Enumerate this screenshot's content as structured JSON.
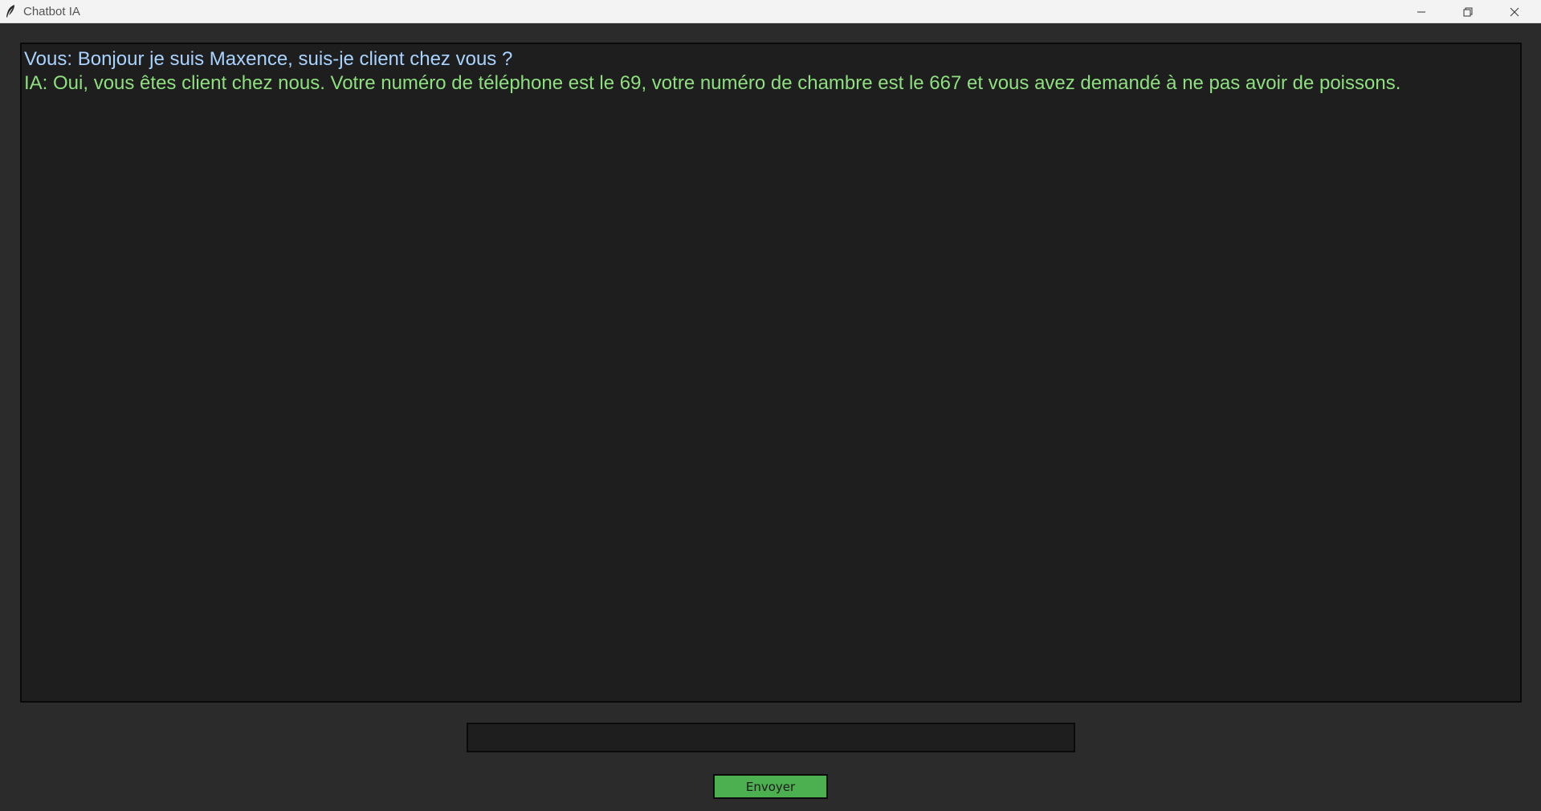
{
  "window": {
    "title": "Chatbot IA",
    "icons": {
      "app": "feather-icon",
      "minimize": "minimize-icon",
      "maximize": "restore-icon",
      "close": "close-icon"
    }
  },
  "chat": {
    "messages": [
      {
        "text": "Vous: Bonjour je suis Maxence, suis-je client chez vous ?"
      },
      {
        "text": "IA: Oui, vous êtes client chez nous. Votre numéro de téléphone est le 69, votre numéro de chambre est le 667 et vous avez demandé à ne pas avoir de poissons."
      }
    ]
  },
  "input": {
    "value": "",
    "placeholder": ""
  },
  "send_button": {
    "label": "Envoyer"
  },
  "colors": {
    "background": "#2b2b2b",
    "chat_background": "#1e1e1e",
    "user_text": "#a9d3ff",
    "ai_text": "#8ee07f",
    "send_button": "#4caf50"
  }
}
